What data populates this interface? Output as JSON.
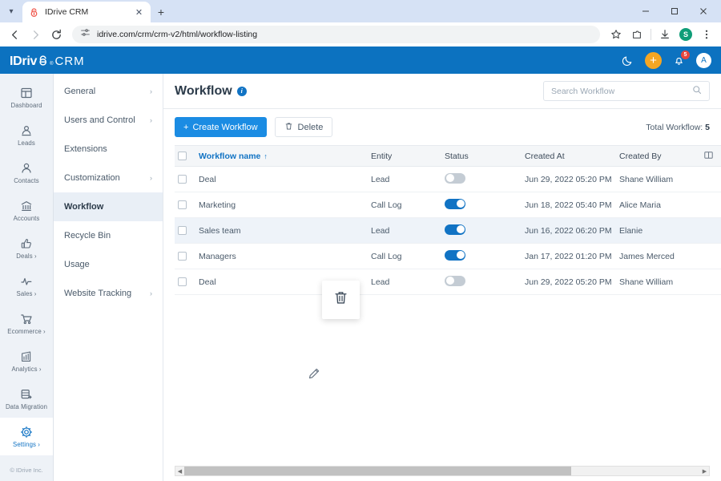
{
  "browser": {
    "tab": {
      "title": "IDrive CRM",
      "favicon_icon": "idrive-favicon",
      "close_icon": "close-icon"
    },
    "tabstrip_chevron_icon": "chevron-down-icon",
    "new_tab_icon": "plus-icon",
    "window_controls": {
      "minimize": "minimize-icon",
      "maximize": "maximize-icon",
      "close": "close-icon"
    },
    "nav": {
      "back_icon": "back-arrow-icon",
      "forward_icon": "forward-arrow-icon",
      "reload_icon": "reload-icon"
    },
    "omnibox": {
      "site_settings_icon": "tune-icon",
      "url": "idrive.com/crm/crm-v2/html/workflow-listing"
    },
    "toolbar_icons": [
      "bookmark-star-icon",
      "extensions-icon",
      "downloads-icon"
    ],
    "profile_initial": "S",
    "menu_icon": "kebab-menu-icon"
  },
  "app_header": {
    "logo": {
      "part1": "IDriv",
      "part2": "e",
      "trademark": "®",
      "suffix": "CRM"
    },
    "dark_mode_icon": "moon-icon",
    "add_button_icon": "plus-icon",
    "notifications": {
      "icon": "bell-icon",
      "count": "5"
    },
    "avatar_initial": "A",
    "brand_color": "#0c72c0",
    "accent_color": "#f5a623"
  },
  "sidebar": {
    "items": [
      {
        "label": "Dashboard",
        "icon": "dashboard-icon",
        "active": false,
        "chevron": ""
      },
      {
        "label": "Leads",
        "icon": "leads-icon",
        "active": false,
        "chevron": ""
      },
      {
        "label": "Contacts",
        "icon": "contacts-icon",
        "active": false,
        "chevron": ""
      },
      {
        "label": "Accounts",
        "icon": "accounts-icon",
        "active": false,
        "chevron": ""
      },
      {
        "label": "Deals ›",
        "icon": "deals-thumbsup-icon",
        "active": false,
        "chevron": "›"
      },
      {
        "label": "Sales ›",
        "icon": "sales-pulse-icon",
        "active": false,
        "chevron": "›"
      },
      {
        "label": "Ecommerce ›",
        "icon": "ecommerce-cart-icon",
        "active": false,
        "chevron": "›"
      },
      {
        "label": "Analytics ›",
        "icon": "analytics-chart-icon",
        "active": false,
        "chevron": "›"
      },
      {
        "label": "Data Migration",
        "icon": "data-migration-icon",
        "active": false,
        "chevron": ""
      },
      {
        "label": "Settings ›",
        "icon": "gear-icon",
        "active": true,
        "chevron": "›"
      }
    ],
    "footer": "© IDrive Inc."
  },
  "subnav": {
    "items": [
      {
        "label": "General",
        "chevron": "›",
        "active": false
      },
      {
        "label": "Users and Control",
        "chevron": "›",
        "active": false
      },
      {
        "label": "Extensions",
        "chevron": "",
        "active": false
      },
      {
        "label": "Customization",
        "chevron": "›",
        "active": false
      },
      {
        "label": "Workflow",
        "chevron": "",
        "active": true
      },
      {
        "label": "Recycle Bin",
        "chevron": "",
        "active": false
      },
      {
        "label": "Usage",
        "chevron": "",
        "active": false
      },
      {
        "label": "Website Tracking",
        "chevron": "›",
        "active": false
      }
    ]
  },
  "main": {
    "title": "Workflow",
    "info_icon": "info-icon",
    "search": {
      "placeholder": "Search Workflow",
      "value": "",
      "icon": "search-icon"
    },
    "create_button": {
      "label": "Create Workflow",
      "icon": "plus-icon"
    },
    "delete_button": {
      "label": "Delete",
      "icon": "trash-icon"
    },
    "total_label": "Total Workflow:",
    "total_value": "5",
    "columns_icon": "column-settings-icon",
    "table": {
      "headers": {
        "select_all": "",
        "name": "Workflow name",
        "sort_arrow": "↑",
        "entity": "Entity",
        "status": "Status",
        "created_at": "Created At",
        "created_by": "Created By"
      },
      "rows": [
        {
          "name": "Deal",
          "entity": "Lead",
          "status_on": false,
          "created_at": "Jun 29, 2022 05:20 PM",
          "created_by": "Shane William",
          "hovered": false
        },
        {
          "name": "Marketing",
          "entity": "Call Log",
          "status_on": true,
          "created_at": "Jun 18, 2022 05:40 PM",
          "created_by": "Alice Maria",
          "hovered": false
        },
        {
          "name": "Sales team",
          "entity": "Lead",
          "status_on": true,
          "created_at": "Jun 16, 2022 06:20 PM",
          "created_by": "Elanie",
          "hovered": true
        },
        {
          "name": "Managers",
          "entity": "Call Log",
          "status_on": true,
          "created_at": "Jan 17, 2022 01:20 PM",
          "created_by": "James Merced",
          "hovered": false
        },
        {
          "name": "Deal",
          "entity": "Lead",
          "status_on": false,
          "created_at": "Jun 29, 2022 05:20 PM",
          "created_by": "Shane William",
          "hovered": false
        }
      ]
    },
    "row_actions": {
      "edit_icon": "pencil-edit-icon",
      "delete_icon": "trash-delete-icon"
    },
    "scrollbar": {
      "left_arrow": "◀",
      "right_arrow": "▶",
      "thumb_pct": "75"
    }
  }
}
